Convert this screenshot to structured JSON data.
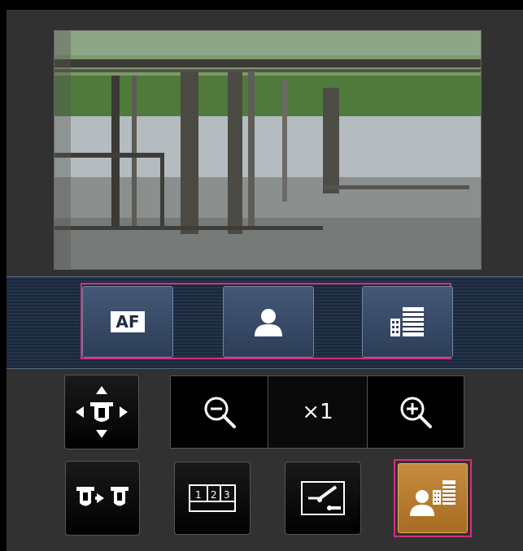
{
  "camera": {
    "label": ""
  },
  "band": {
    "af_label": "AF",
    "af_icon": "af-icon",
    "person_icon": "person-icon",
    "scene_icon": "building-list-icon"
  },
  "controls": {
    "pan_tilt_icon": "pan-tilt-icon",
    "zoom_out_icon": "zoom-out-icon",
    "zoom_level": "×1",
    "zoom_in_icon": "zoom-in-icon",
    "preset_move_icon": "preset-move-icon",
    "multi_screen_icon": "multi-screen-icon",
    "brightness_icon": "brightness-slider-icon",
    "preset_scene_icon": "person-building-icon"
  },
  "colors": {
    "selected_border": "#d6307a",
    "band_blue": "#24344a",
    "active_orange": "#b87a2e"
  }
}
